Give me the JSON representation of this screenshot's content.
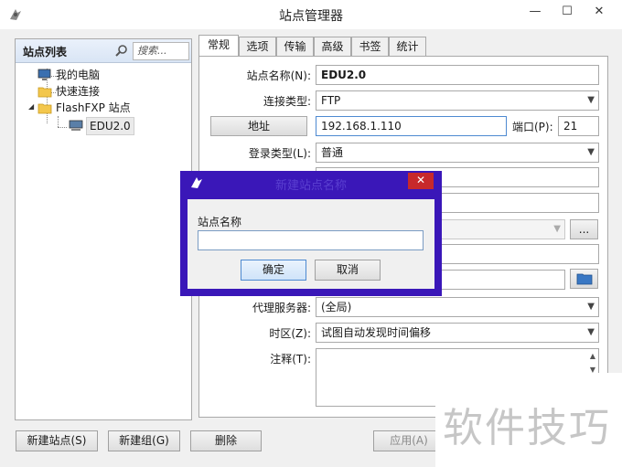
{
  "window": {
    "title": "站点管理器",
    "minimize": "—",
    "maximize": "☐",
    "close": "✕"
  },
  "left": {
    "title": "站点列表",
    "search_placeholder": "搜索...",
    "tree": [
      {
        "label": "我的电脑",
        "icon": "computer-icon"
      },
      {
        "label": "快速连接",
        "icon": "folder-icon"
      },
      {
        "label": "FlashFXP 站点",
        "icon": "folder-icon",
        "expanded": true
      },
      {
        "label": "EDU2.0",
        "icon": "site-icon",
        "selected": true
      }
    ]
  },
  "tabs": [
    "常规",
    "选项",
    "传输",
    "高级",
    "书签",
    "统计"
  ],
  "active_tab": "常规",
  "general": {
    "site_name_label": "站点名称(N):",
    "site_name_value": "EDU2.0",
    "conn_type_label": "连接类型:",
    "conn_type_value": "FTP",
    "address_button": "地址",
    "address_value": "192.168.1.110",
    "port_label": "端口(P):",
    "port_value": "21",
    "login_type_label": "登录类型(L):",
    "login_type_value": "普通",
    "browse_button": "...",
    "proxy_label": "代理服务器:",
    "proxy_value": "(全局)",
    "timezone_label": "时区(Z):",
    "timezone_value": "试图自动发现时间偏移",
    "notes_label": "注释(T):"
  },
  "bottom": {
    "new_site": "新建站点(S)",
    "new_group": "新建组(G)",
    "delete": "删除",
    "apply": "应用(A)"
  },
  "dialog": {
    "title": "新建站点名称",
    "close": "✕",
    "field_label": "站点名称",
    "field_value": "",
    "ok": "确定",
    "cancel": "取消"
  },
  "watermark": "软件技巧",
  "colors": {
    "dialog_frame": "#3a17b8",
    "dialog_close": "#c7292b",
    "focus_border": "#4e8ad1"
  }
}
